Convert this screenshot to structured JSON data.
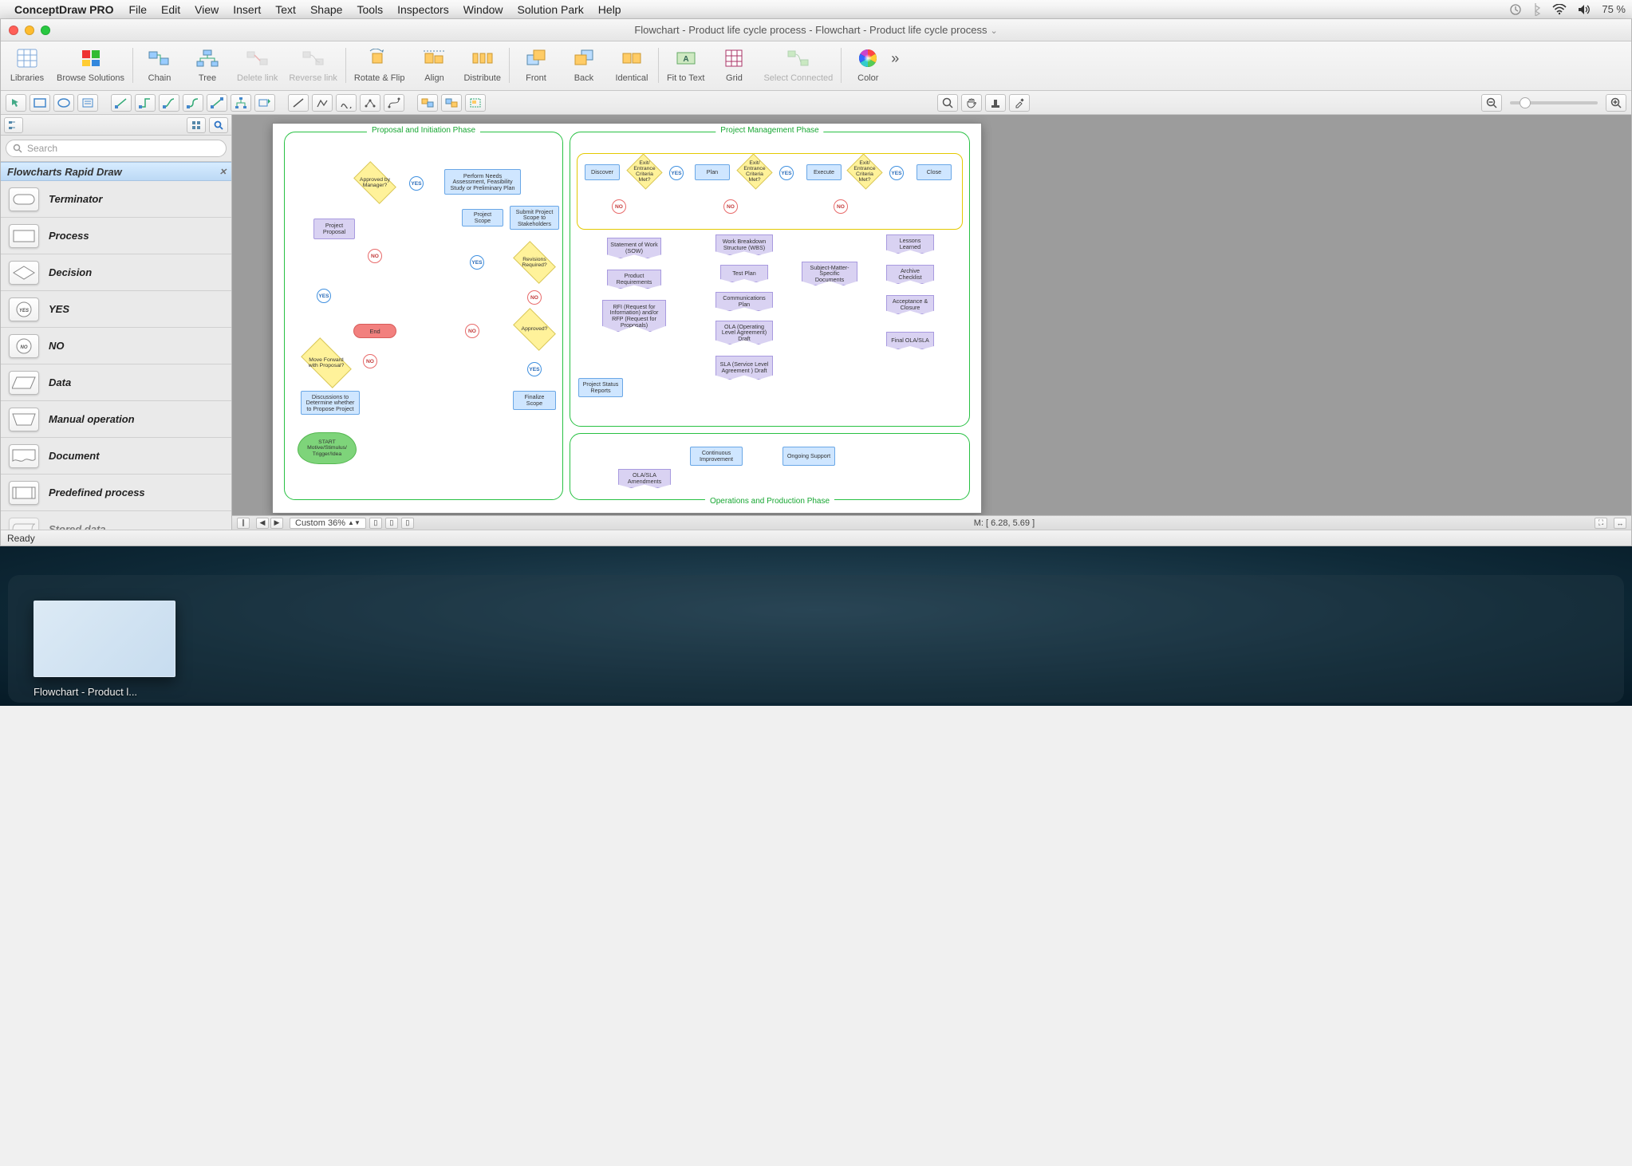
{
  "menubar": {
    "app_name": "ConceptDraw PRO",
    "items": [
      "File",
      "Edit",
      "View",
      "Insert",
      "Text",
      "Shape",
      "Tools",
      "Inspectors",
      "Window",
      "Solution Park",
      "Help"
    ],
    "battery": "75 %"
  },
  "window": {
    "title": "Flowchart - Product life cycle process - Flowchart - Product life cycle process"
  },
  "toolbar": {
    "libraries": "Libraries",
    "browse_solutions": "Browse Solutions",
    "chain": "Chain",
    "tree": "Tree",
    "delete_link": "Delete link",
    "reverse_link": "Reverse link",
    "rotate_flip": "Rotate & Flip",
    "align": "Align",
    "distribute": "Distribute",
    "front": "Front",
    "back": "Back",
    "identical": "Identical",
    "fit_to_text": "Fit to Text",
    "grid": "Grid",
    "select_connected": "Select Connected",
    "color": "Color"
  },
  "sidebar": {
    "search_placeholder": "Search",
    "library_title": "Flowcharts Rapid Draw",
    "shapes": [
      "Terminator",
      "Process",
      "Decision",
      "YES",
      "NO",
      "Data",
      "Manual operation",
      "Document",
      "Predefined process",
      "Stored data"
    ]
  },
  "canvas": {
    "phase1_title": "Proposal and Initiation Phase",
    "phase2_title": "Project Management Phase",
    "phase3_title": "Operations and Production Phase",
    "p1": {
      "approved_by_manager": "Approved by Manager?",
      "perform_needs": "Perform Needs Assessment, Feasibility Study or Preliminary Plan",
      "project_scope": "Project Scope",
      "submit_scope": "Submit Project Scope to Stakeholders",
      "revisions_required": "Revisions Required?",
      "approved": "Approved?",
      "project_proposal": "Project Proposal",
      "move_forward": "Move Forward with Proposal?",
      "discussions": "Discussions to Determine whether to Propose Project",
      "start_cloud": "START Motive/Stimulus/ Trigger/Idea",
      "end": "End",
      "finalize_scope": "Finalize Scope"
    },
    "p2": {
      "discover": "Discover",
      "plan": "Plan",
      "execute": "Execute",
      "close": "Close",
      "exit_criteria": "Exit/ Entrance Criteria Met?",
      "sow": "Statement of Work (SOW)",
      "product_req": "Product Requirements",
      "rfi_rfp": "RFI (Request for Information) and/or RFP (Request for Proposals)",
      "status_reports": "Project Status Reports",
      "wbs": "Work Breakdown Structure (WBS)",
      "test_plan": "Test Plan",
      "comm_plan": "Communications Plan",
      "ola_draft": "OLA (Operating Level Agreement) Draft",
      "sla_draft": "SLA (Service Level Agreement ) Draft",
      "sme_docs": "Subject-Matter-Specific Documents",
      "lessons": "Lessons Learned",
      "archive": "Archive Checklist",
      "acceptance": "Acceptance & Closure",
      "final_ola_sla": "Final OLA/SLA"
    },
    "p3": {
      "cont_improve": "Continuous Improvement",
      "ongoing_support": "Ongoing Support",
      "ola_sla_amend": "OLA/SLA Amendments"
    },
    "yes": "YES",
    "no": "NO"
  },
  "bottom": {
    "zoom_label": "Custom 36%",
    "mouse": "M: [ 6.28, 5.69 ]"
  },
  "status": {
    "ready": "Ready"
  },
  "dock": {
    "thumb_label": "Flowchart - Product l..."
  }
}
